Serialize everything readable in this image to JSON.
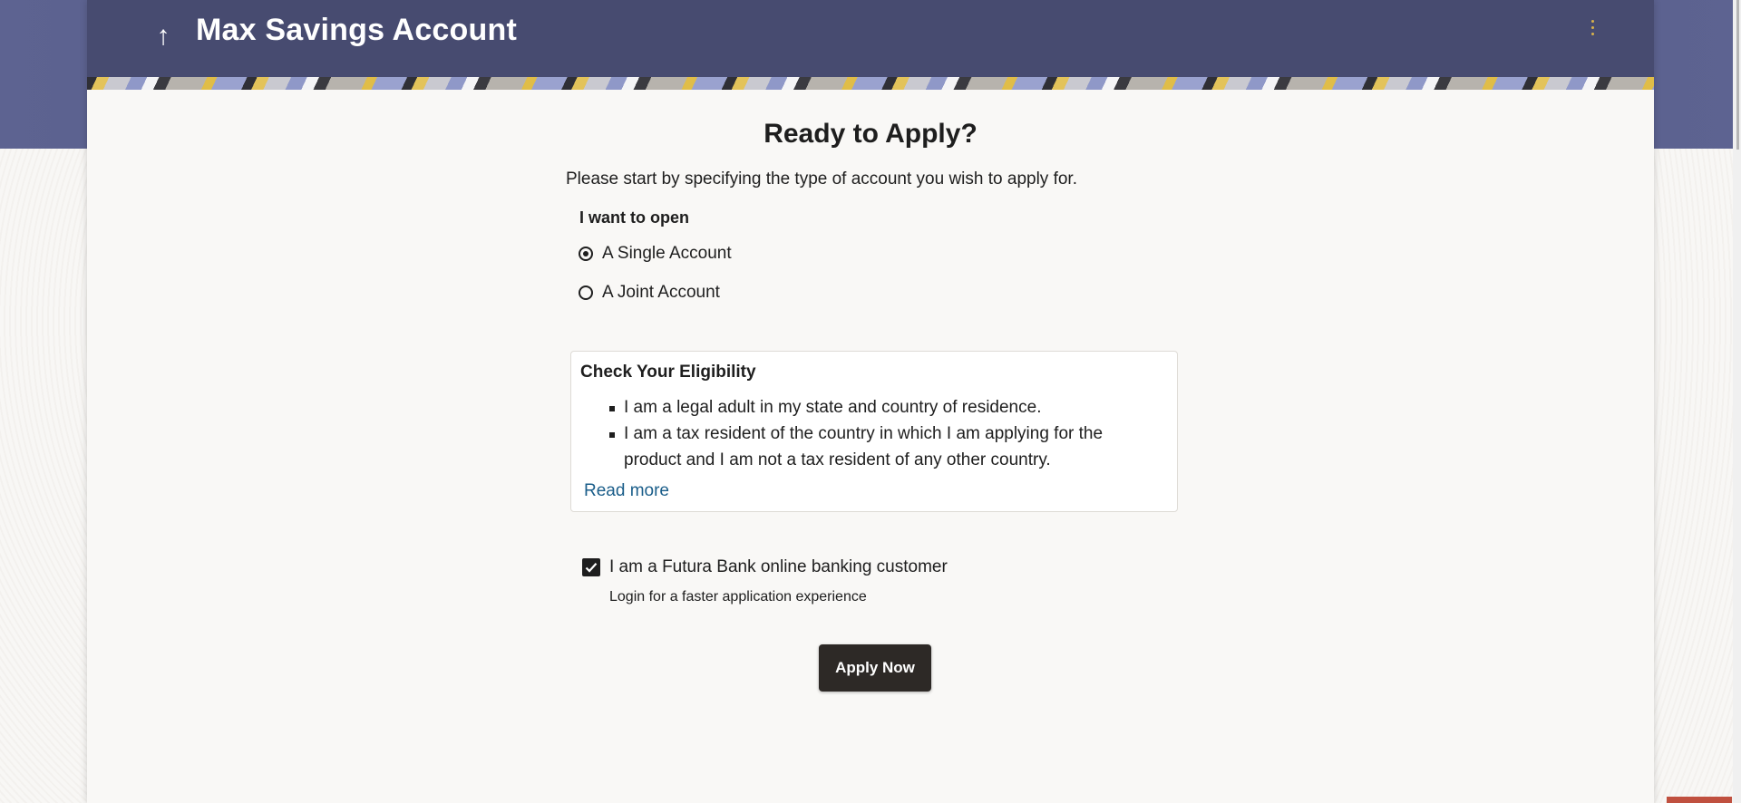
{
  "header": {
    "back_icon": "up-arrow-icon",
    "title": "Max Savings Account",
    "menu_icon": "kebab-menu-icon"
  },
  "main": {
    "heading": "Ready to Apply?",
    "subtitle": "Please start by specifying the type of account you wish to apply for.",
    "account_type": {
      "label": "I want to open",
      "options": [
        {
          "label": "A Single Account",
          "selected": true
        },
        {
          "label": "A Joint Account",
          "selected": false
        }
      ]
    },
    "eligibility": {
      "title": "Check Your Eligibility",
      "items": [
        "I am a legal adult in my state and country of residence.",
        "I am a tax resident of the country in which I am applying for the product and I am not a tax resident of any other country."
      ],
      "read_more": "Read more"
    },
    "customer": {
      "label": "I am a Futura Bank online banking customer",
      "checked": true,
      "hint": "Login for a faster application experience"
    },
    "apply_button": "Apply Now"
  },
  "colors": {
    "header_bg": "#474b70",
    "button_bg": "#2d2926",
    "link": "#1b5e8a"
  }
}
